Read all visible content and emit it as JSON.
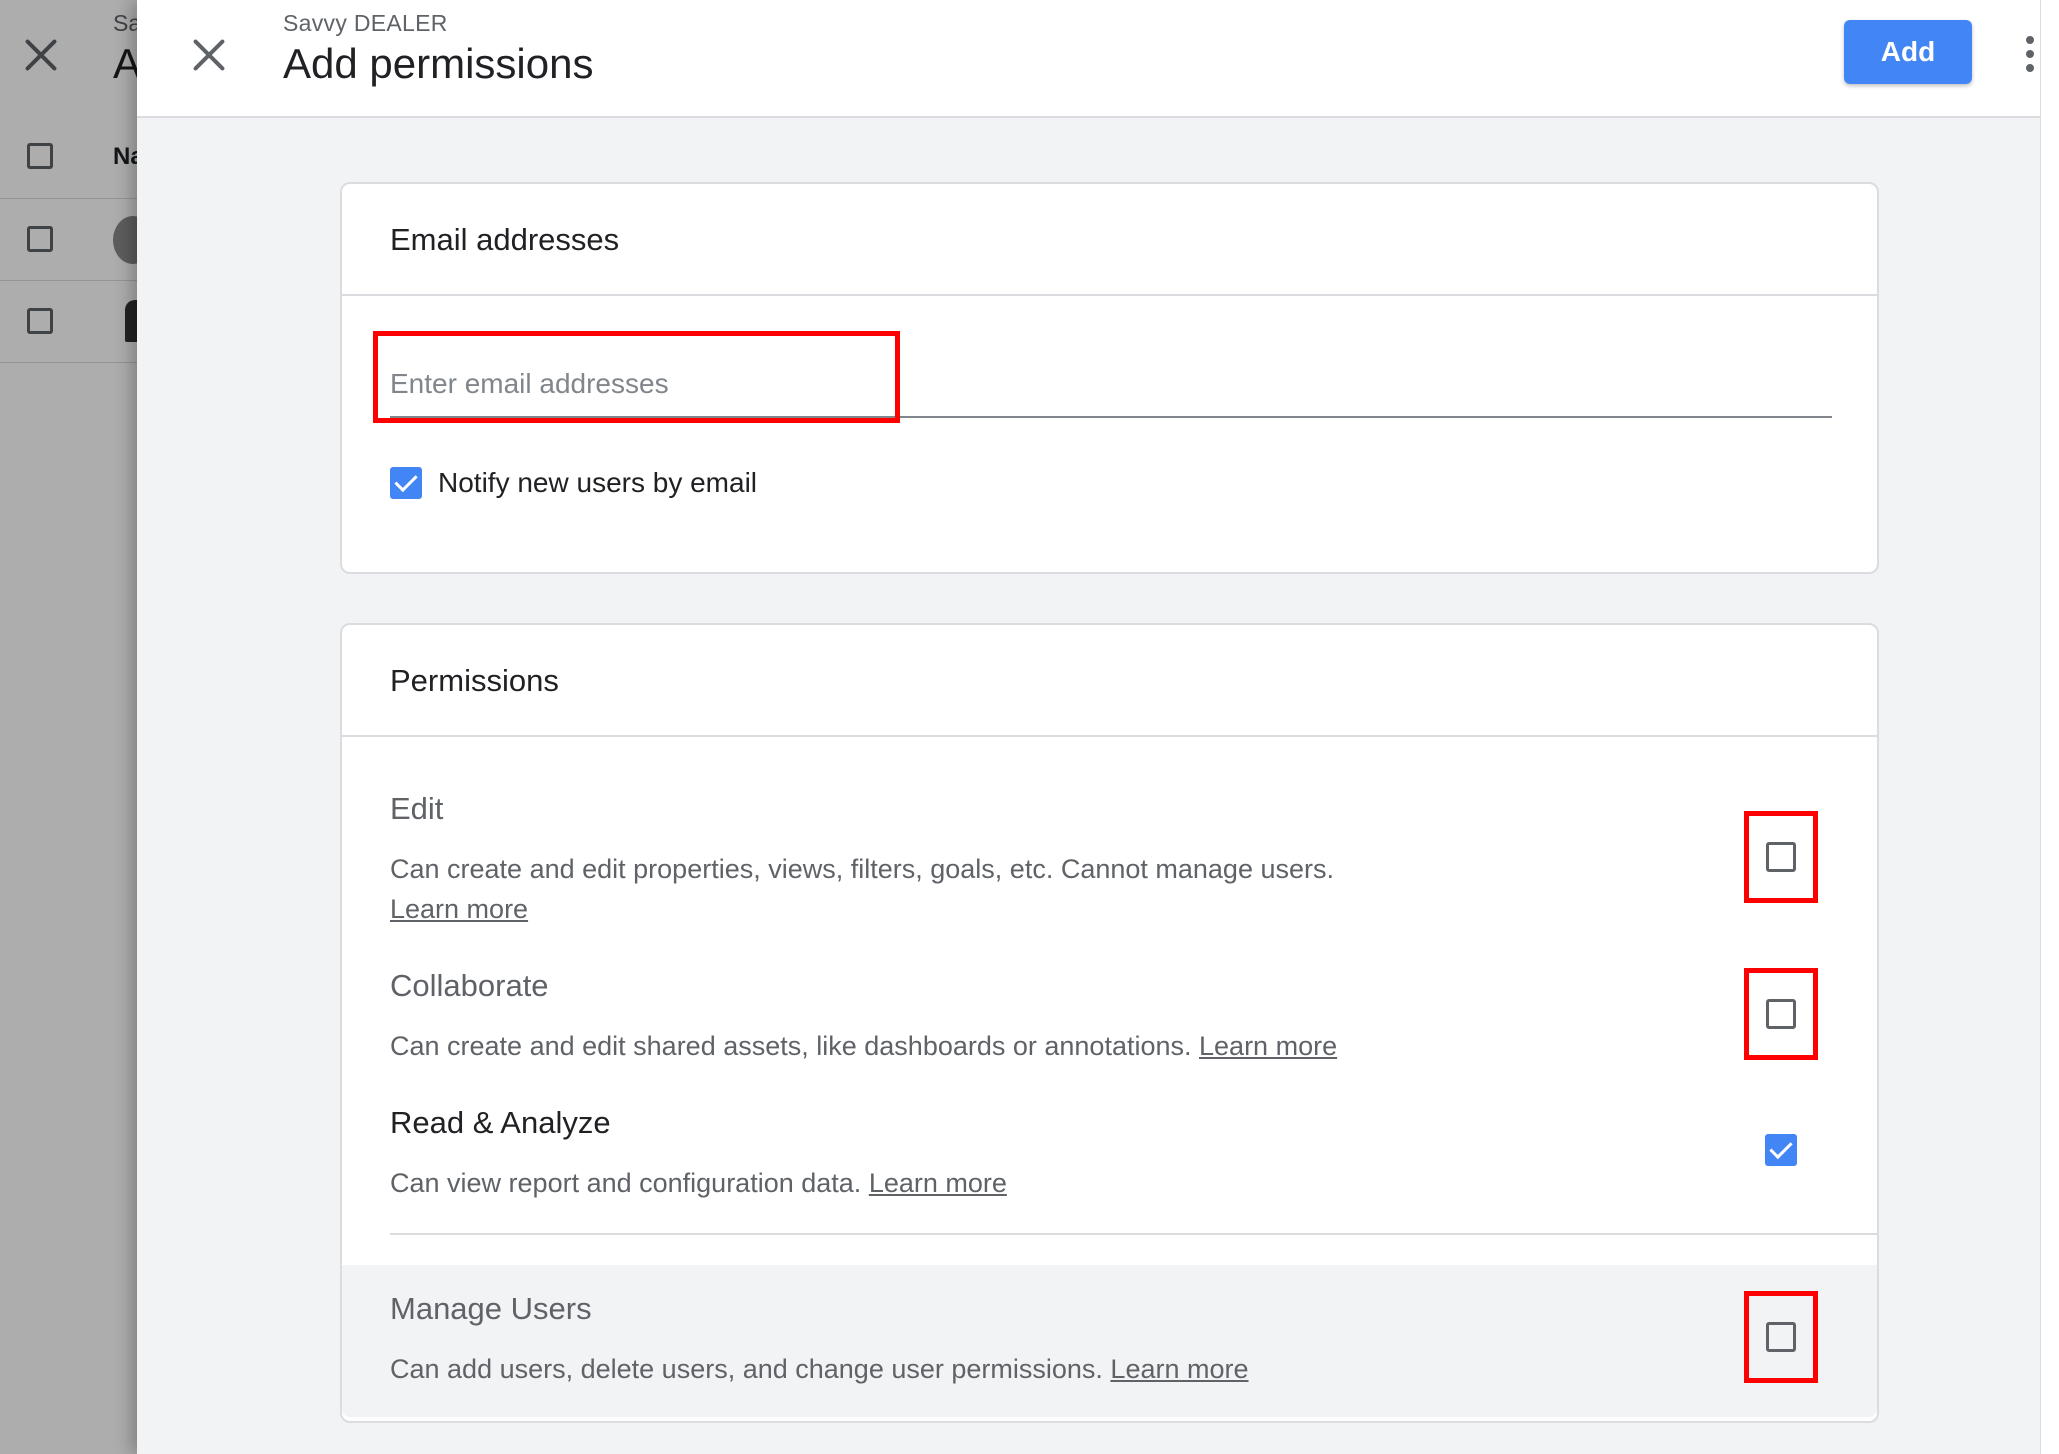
{
  "background": {
    "subtitle_fragment": "Sa",
    "title_fragment": "A",
    "header_fragment": "Na"
  },
  "dialog": {
    "account_name": "Savvy DEALER",
    "title": "Add permissions",
    "add_label": "Add"
  },
  "email_card": {
    "title": "Email addresses",
    "placeholder": "Enter email addresses",
    "value": "",
    "notify_label": "Notify new users by email",
    "notify_checked": true
  },
  "permissions_card": {
    "title": "Permissions",
    "items": [
      {
        "name": "Edit",
        "description": "Can create and edit properties, views, filters, goals, etc. Cannot manage users.",
        "link": "Learn more",
        "checked": false
      },
      {
        "name": "Collaborate",
        "description": "Can create and edit shared assets, like dashboards or annotations.",
        "link": "Learn more",
        "checked": false
      },
      {
        "name": "Read & Analyze",
        "description": "Can view report and configuration data.",
        "link": "Learn more",
        "checked": true
      },
      {
        "name": "Manage Users",
        "description": "Can add users, delete users, and change user permissions.",
        "link": "Learn more",
        "checked": false
      }
    ]
  },
  "colors": {
    "accent": "#4285f4",
    "highlight": "#ff0000"
  },
  "icons": [
    "close-icon",
    "more-vert-icon",
    "checkbox-icon"
  ]
}
